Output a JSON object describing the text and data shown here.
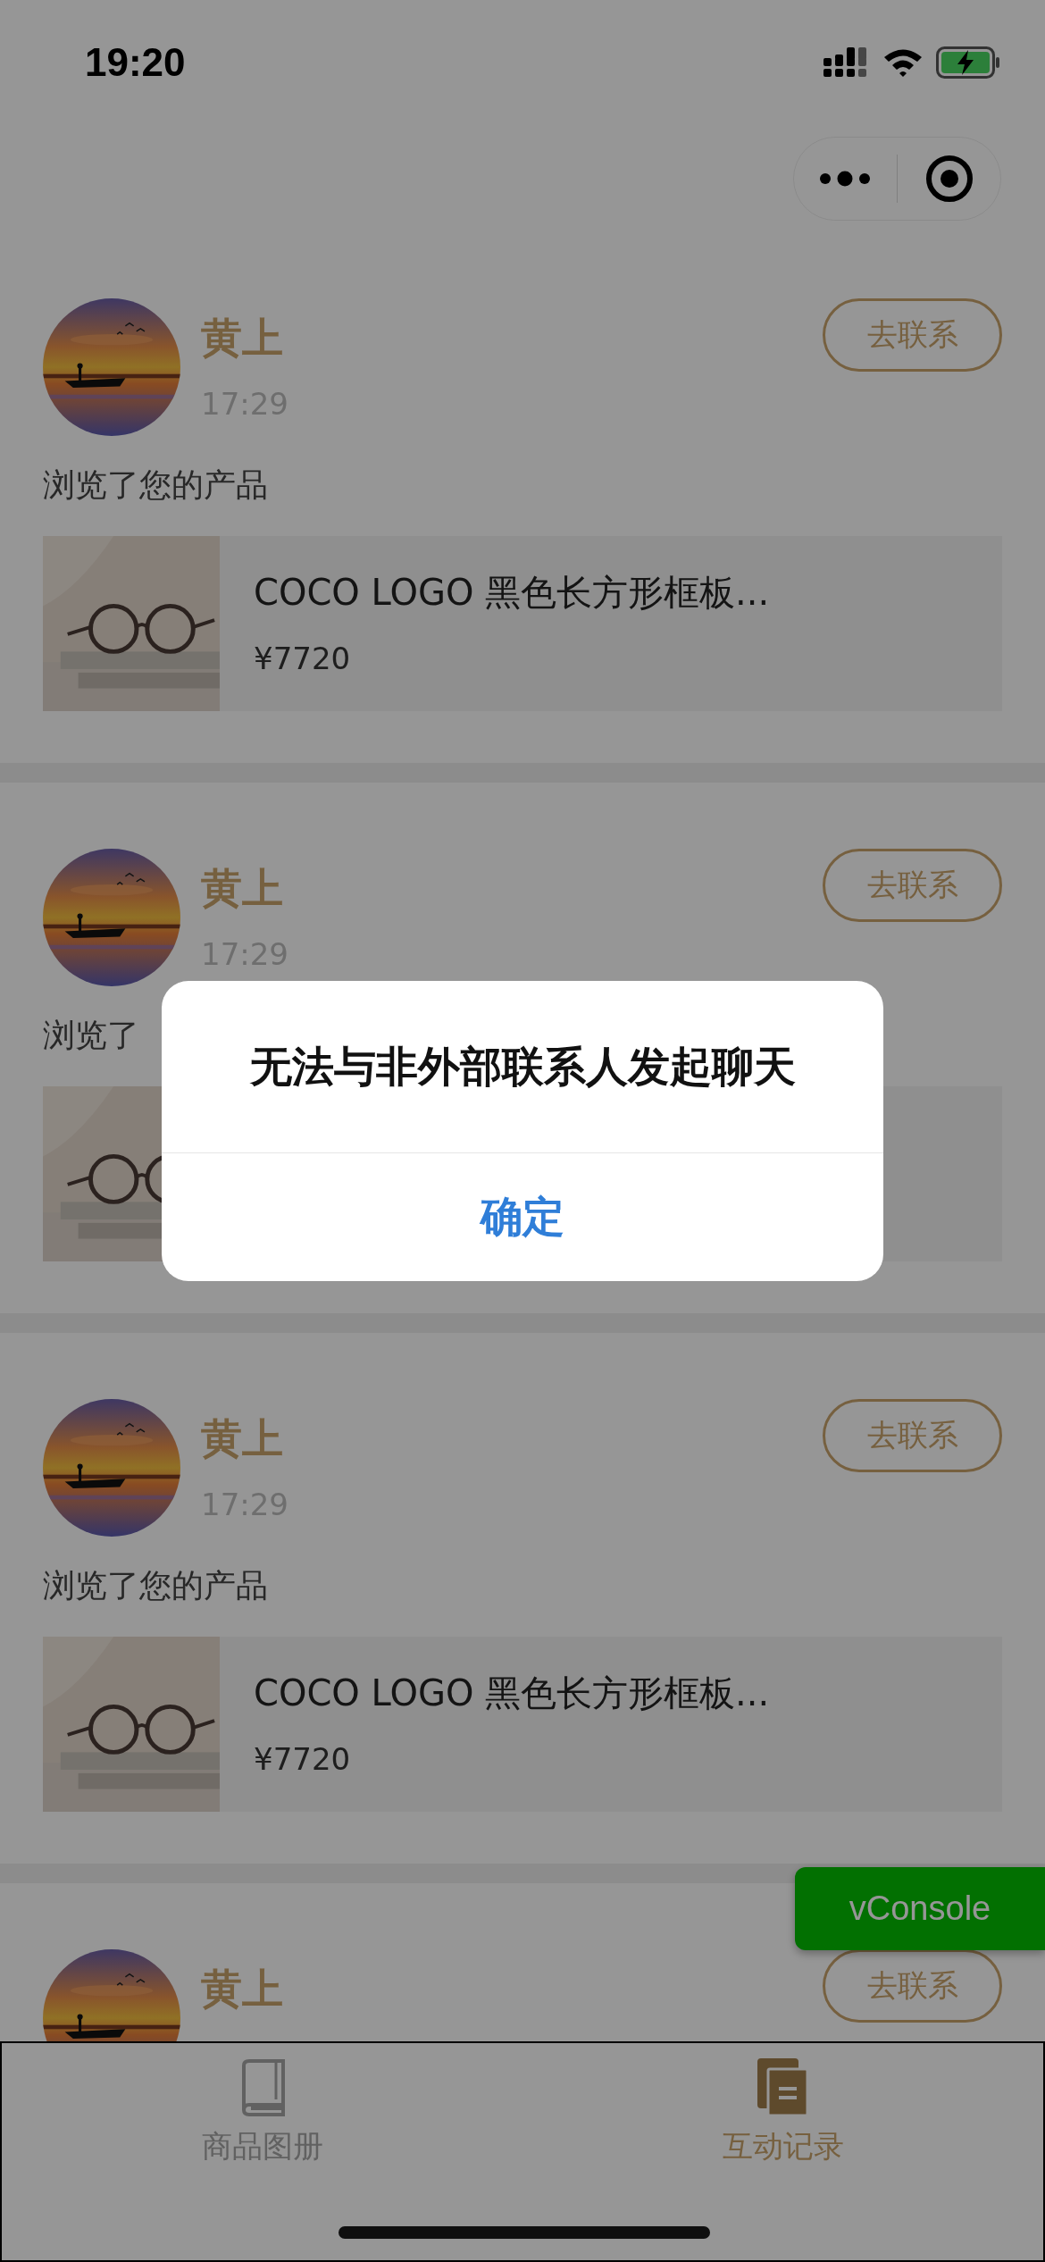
{
  "status_bar": {
    "time": "19:20"
  },
  "cards": [
    {
      "name": "黄上",
      "time": "17:29",
      "action": "去联系",
      "activity": "浏览了您的产品",
      "product": {
        "kind": "picture",
        "title": "COCO LOGO 黑色长方形框板...",
        "price": "¥7720"
      }
    },
    {
      "name": "黄上",
      "time": "17:29",
      "action": "去联系",
      "activity": "浏览了"
    },
    {
      "name": "黄上",
      "time": "17:29",
      "action": "去联系",
      "activity": "浏览了您的产品",
      "product": {
        "kind": "picture",
        "title": "COCO LOGO 黑色长方形框板...",
        "price": "¥7720"
      }
    },
    {
      "name": "黄上",
      "action": "去联系"
    }
  ],
  "floating_button": {
    "label": "vConsole"
  },
  "tab_bar": [
    {
      "label": "商品图册",
      "selected": false
    },
    {
      "label": "互动记录",
      "selected": true
    }
  ],
  "dialog": {
    "message": "无法与非外部联系人发起聊天",
    "button": "确定"
  }
}
